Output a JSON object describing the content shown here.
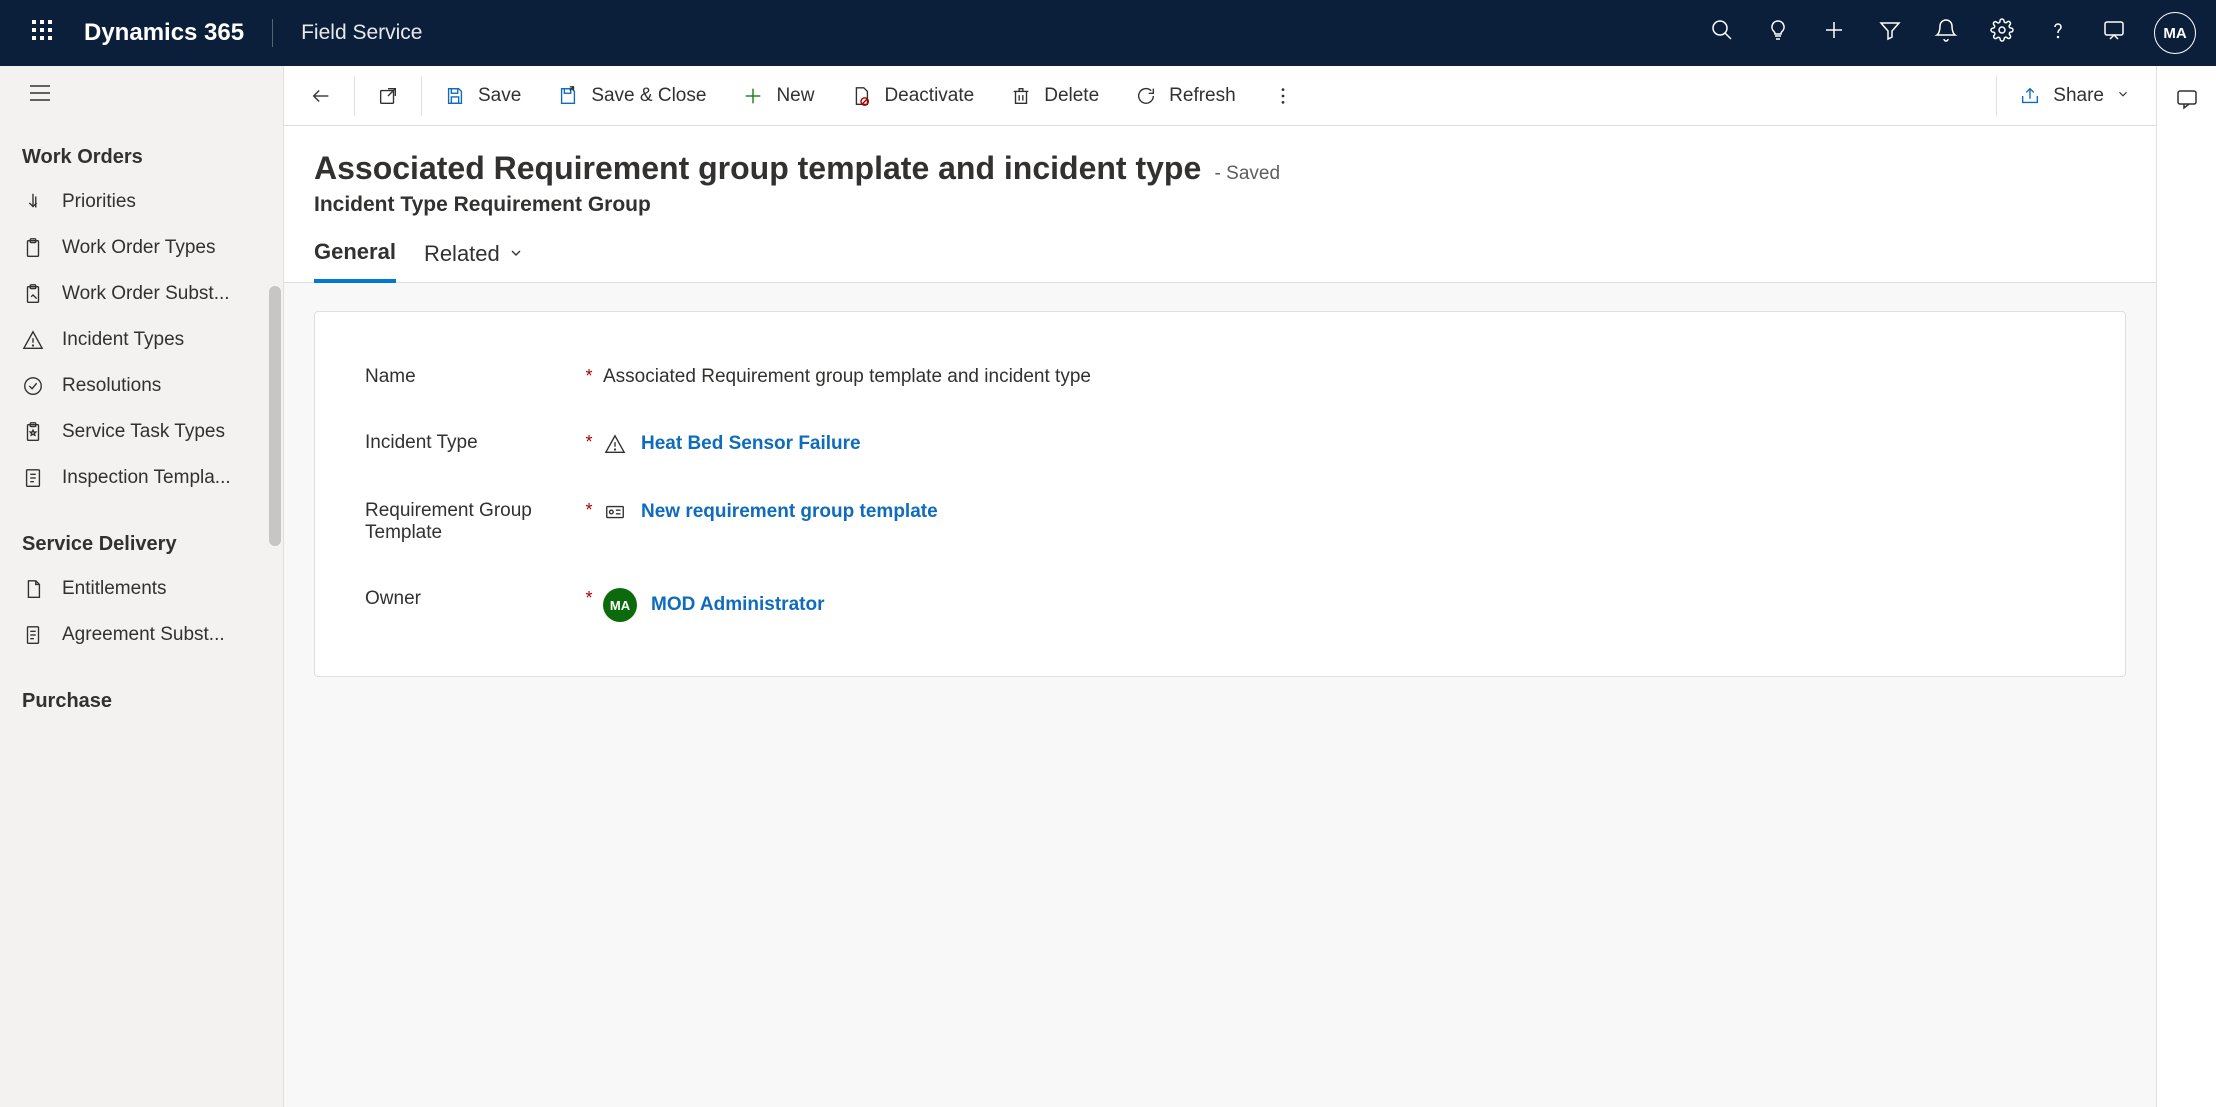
{
  "topbar": {
    "brand": "Dynamics 365",
    "app": "Field Service",
    "avatar": "MA"
  },
  "sidebar": {
    "groups": [
      {
        "heading": "Work Orders",
        "items": [
          {
            "label": "Priorities",
            "icon": "priority"
          },
          {
            "label": "Work Order Types",
            "icon": "clipboard"
          },
          {
            "label": "Work Order Subst...",
            "icon": "clipboard-edit"
          },
          {
            "label": "Incident Types",
            "icon": "warning"
          },
          {
            "label": "Resolutions",
            "icon": "check-circle"
          },
          {
            "label": "Service Task Types",
            "icon": "clipboard-star"
          },
          {
            "label": "Inspection Templa...",
            "icon": "form"
          }
        ]
      },
      {
        "heading": "Service Delivery",
        "items": [
          {
            "label": "Entitlements",
            "icon": "page"
          },
          {
            "label": "Agreement Subst...",
            "icon": "document"
          }
        ]
      },
      {
        "heading": "Purchase",
        "items": []
      }
    ]
  },
  "commandbar": {
    "save": "Save",
    "saveclose": "Save & Close",
    "new": "New",
    "deactivate": "Deactivate",
    "delete": "Delete",
    "refresh": "Refresh",
    "share": "Share"
  },
  "form": {
    "title": "Associated Requirement group template and incident type",
    "saved": "- Saved",
    "subtitle": "Incident Type Requirement Group",
    "tabs": {
      "general": "General",
      "related": "Related"
    },
    "fields": {
      "name": {
        "label": "Name",
        "value": "Associated Requirement group template and incident type"
      },
      "incidentType": {
        "label": "Incident Type",
        "value": "Heat Bed Sensor Failure"
      },
      "reqGroupTemplate": {
        "label": "Requirement Group Template",
        "value": "New requirement group template"
      },
      "owner": {
        "label": "Owner",
        "value": "MOD Administrator",
        "initials": "MA"
      }
    }
  }
}
